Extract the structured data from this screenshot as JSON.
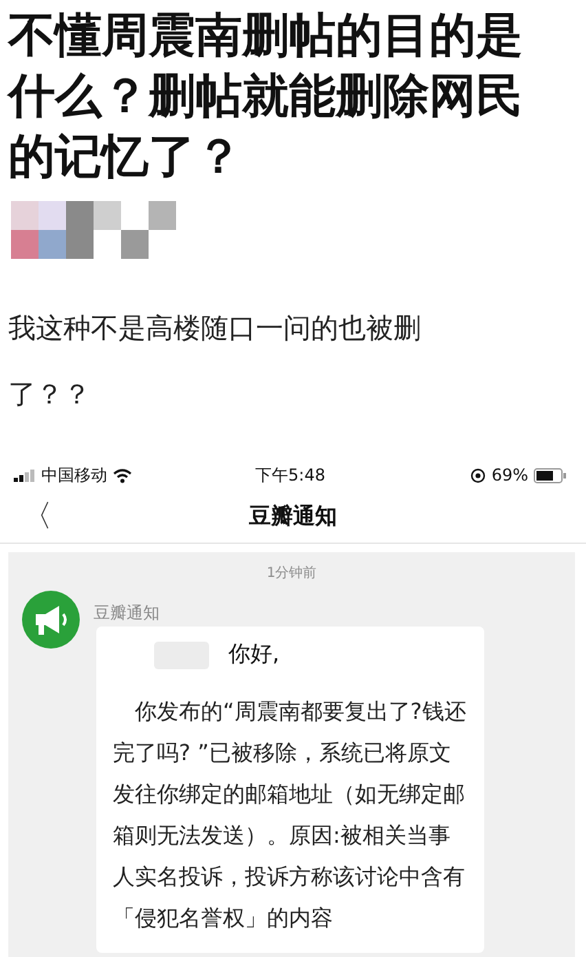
{
  "post": {
    "title": "不懂周震南删帖的目的是什么？删帖就能删除网民的记忆了？",
    "body": "我这种不是高楼随口一问的也被删了？？"
  },
  "phone": {
    "status_bar": {
      "carrier": "中国移动",
      "time": "下午5:48",
      "battery": "69%"
    },
    "nav": {
      "back": "〈",
      "title": "豆瓣通知"
    },
    "message": {
      "time": "1分钟前",
      "sender": "豆瓣通知",
      "greeting": "你好,",
      "body": "你发布的“周震南都要复出了?钱还完了吗? ”已被移除，系统已将原文发往你绑定的邮箱地址（如无绑定邮箱则无法发送）。原因:被相关当事人实名投诉，投诉方称该讨论中含有「侵犯名誉权」的内容"
    }
  }
}
